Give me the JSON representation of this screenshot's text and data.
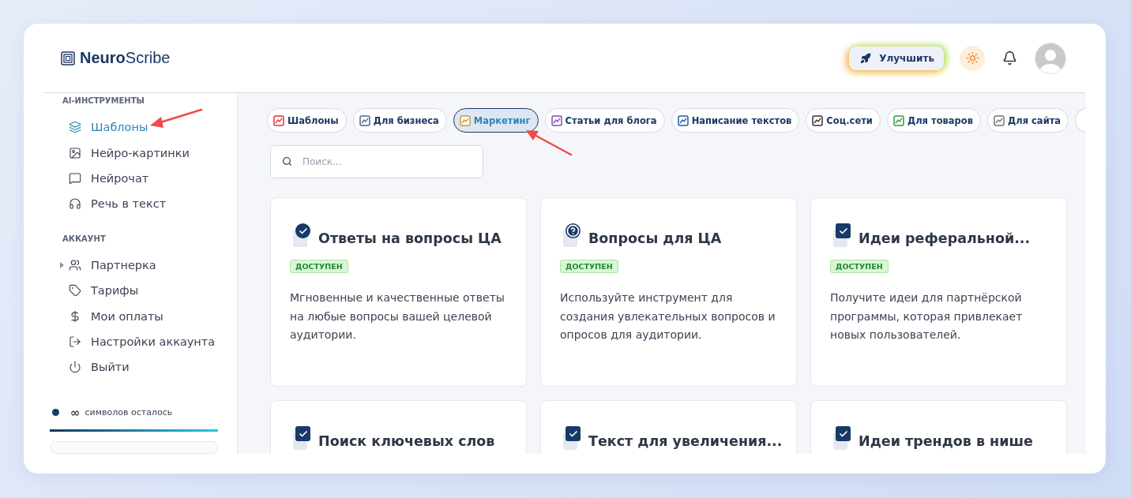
{
  "logo": {
    "bold": "Neuro",
    "light": "Scribe"
  },
  "header": {
    "upgrade_button": "Улучшить"
  },
  "sidebar": {
    "sections": [
      {
        "title": "AI-ИНСТРУМЕНТЫ",
        "items": [
          {
            "label": "Шаблоны",
            "selected": true
          },
          {
            "label": "Нейро-картинки",
            "selected": false
          },
          {
            "label": "Нейрочат",
            "selected": false
          },
          {
            "label": "Речь в текст",
            "selected": false
          }
        ]
      },
      {
        "title": "АККАУНТ",
        "items": [
          {
            "label": "Партнерка",
            "selected": false,
            "expanded": false
          },
          {
            "label": "Тарифы",
            "selected": false
          },
          {
            "label": "Мои оплаты",
            "selected": false
          },
          {
            "label": "Настройки аккаунта",
            "selected": false
          },
          {
            "label": "Выйти",
            "selected": false
          }
        ]
      }
    ],
    "quota": {
      "amount": "∞",
      "label": "символов осталось",
      "level": 1
    }
  },
  "categories": [
    {
      "label": "Шаблоны",
      "selected": false
    },
    {
      "label": "Для бизнеса",
      "selected": false
    },
    {
      "label": "Маркетинг",
      "selected": true
    },
    {
      "label": "Статьи для блога",
      "selected": false
    },
    {
      "label": "Написание текстов",
      "selected": false
    },
    {
      "label": "Соц.сети",
      "selected": false
    },
    {
      "label": "Для товаров",
      "selected": false
    },
    {
      "label": "Для сайта",
      "selected": false
    }
  ],
  "search": {
    "placeholder": "Поиск..."
  },
  "cards": [
    {
      "kind": "check-round",
      "title": "Ответы на вопросы ЦА",
      "badge": "ДОСТУПЕН",
      "description": "Мгновенные и качественные ответы на любые вопросы вашей целевой аудитории."
    },
    {
      "kind": "question",
      "title": "Вопросы для ЦА",
      "badge": "ДОСТУПЕН",
      "description": "Используйте инструмент для создания увлекательных вопросов и опросов для аудитории."
    },
    {
      "kind": "check-square",
      "title": "Идеи реферальной...",
      "badge": "ДОСТУПЕН",
      "description": "Получите идеи для партнёрской программы, которая привлекает новых пользователей."
    },
    {
      "kind": "check-square",
      "title": "Поиск ключевых слов"
    },
    {
      "kind": "check-square",
      "title": "Текст для увеличения..."
    },
    {
      "kind": "check-square",
      "title": "Идеи трендов в нише"
    }
  ]
}
